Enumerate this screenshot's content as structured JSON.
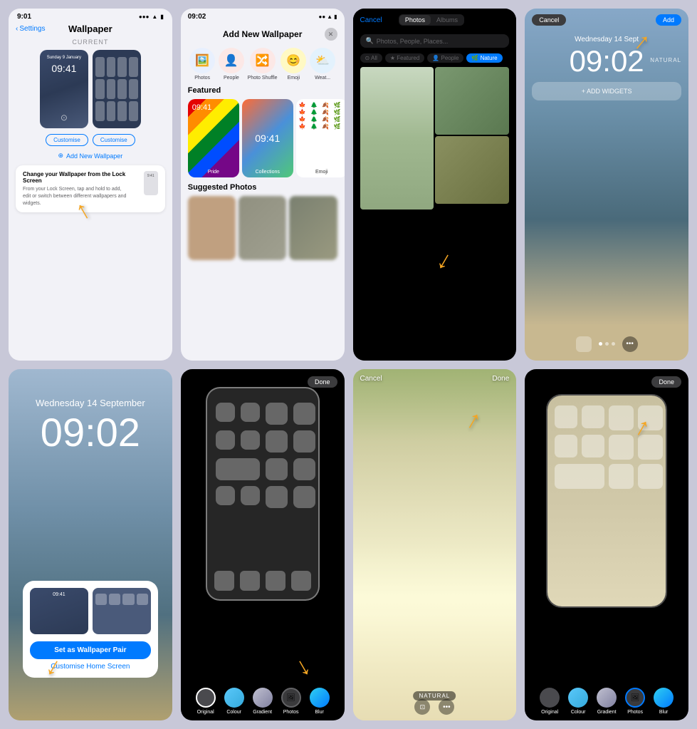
{
  "page": {
    "background": "#c8c8d8"
  },
  "cell1": {
    "status_time": "9:01",
    "status_signal": "●●●",
    "nav_back": "Settings",
    "nav_title": "Wallpaper",
    "current_label": "CURRENT",
    "lock_date": "Sunday 9 January",
    "lock_time": "09:41",
    "customise_lock": "Customise",
    "customise_home": "Customise",
    "add_wallpaper": "Add New Wallpaper",
    "tooltip_title": "Change your Wallpaper from the Lock Screen",
    "tooltip_body": "From your Lock Screen, tap and hold to add, edit or switch between different wallpapers and widgets.",
    "mini_time": "9:41"
  },
  "cell2": {
    "status_time": "09:02",
    "modal_title": "Add New Wallpaper",
    "close_icon": "×",
    "icons": [
      {
        "label": "Photos",
        "emoji": "🖼️",
        "bg": "#e8f0fe"
      },
      {
        "label": "People",
        "emoji": "👤",
        "bg": "#fce8e6"
      },
      {
        "label": "Photo Shuffle",
        "emoji": "🔀",
        "bg": "#fce8e6"
      },
      {
        "label": "Emoji",
        "emoji": "😊",
        "bg": "#fff9c4"
      },
      {
        "label": "Weat...",
        "emoji": "⛅",
        "bg": "#e3f2fd"
      }
    ],
    "featured_label": "Featured",
    "cards": [
      {
        "label": "Pride"
      },
      {
        "label": "Collections"
      },
      {
        "label": "Emoji"
      }
    ],
    "suggested_label": "Suggested Photos",
    "emoji_items": [
      "🍁",
      "🌲",
      "🍂",
      "🌿",
      "🍁",
      "🌲",
      "🍂",
      "🌿",
      "🍁",
      "🌲",
      "🍂",
      "🌿"
    ]
  },
  "cell3": {
    "cancel": "Cancel",
    "tabs": [
      "Photos",
      "Albums"
    ],
    "active_tab": "Photos",
    "search_placeholder": "Photos, People, Places...",
    "filters": [
      "All",
      "Featured",
      "People",
      "Nature"
    ],
    "active_filter": "Nature"
  },
  "cell4": {
    "cancel": "Cancel",
    "add": "Add",
    "date": "Wednesday 14 Sept",
    "time": "09:02",
    "widgets_label": "+ ADD WIDGETS",
    "natural": "NATURAL",
    "dots": 3,
    "active_dot": 0
  },
  "cell5": {
    "date": "Wednesday 14 September",
    "time": "09:02",
    "set_btn": "Set as Wallpaper Pair",
    "customise": "Customise Home Screen",
    "lock_time": "09:41"
  },
  "cell6": {
    "done": "Done",
    "options": [
      "Original",
      "Colour",
      "Gradient",
      "Photos",
      "Blur"
    ]
  },
  "cell7": {
    "cancel": "Cancel",
    "done": "Done",
    "natural": "NATURAL"
  },
  "cell8": {
    "done": "Done",
    "options": [
      "Original",
      "Colour",
      "Gradient",
      "Photos",
      "Blur"
    ],
    "selected": "Photos"
  }
}
